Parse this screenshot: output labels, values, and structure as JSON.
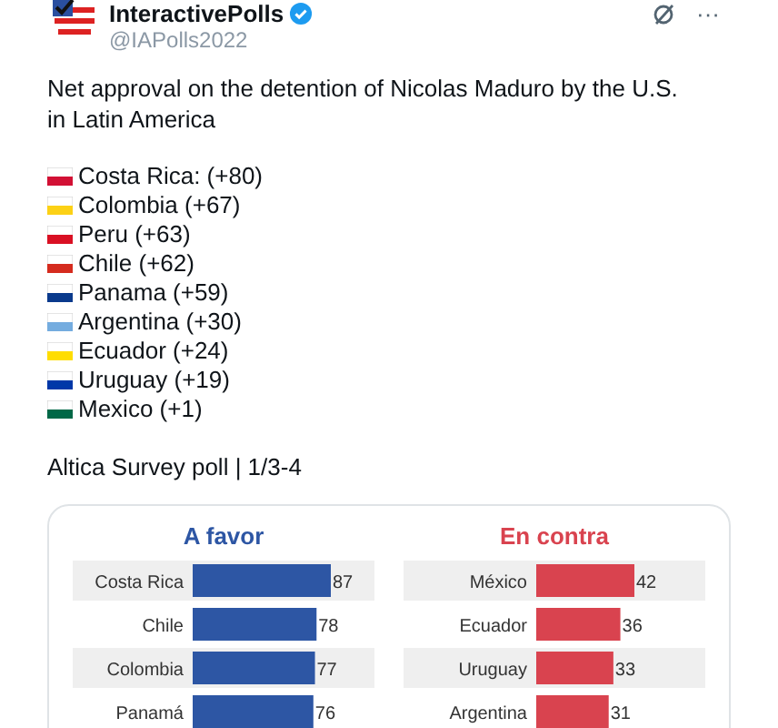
{
  "post": {
    "author": "InteractivePolls",
    "verified": true,
    "handle": "@IAPolls2022",
    "more": "···",
    "text": "Net approval on the detention of Nicolas Maduro by the U.S. in Latin America",
    "list": [
      {
        "label": "Costa Rica: (+80)",
        "color": "#d21034"
      },
      {
        "label": "Colombia (+67)",
        "color": "#fcd116"
      },
      {
        "label": "Peru (+63)",
        "color": "#d91023"
      },
      {
        "label": "Chile (+62)",
        "color": "#d52b1e"
      },
      {
        "label": "Panama (+59)",
        "color": "#0a3a8c"
      },
      {
        "label": "Argentina (+30)",
        "color": "#74acdf"
      },
      {
        "label": "Ecuador (+24)",
        "color": "#ffdd00"
      },
      {
        "label": "Uruguay (+19)",
        "color": "#0038a8"
      },
      {
        "label": "Mexico (+1)",
        "color": "#006847"
      }
    ],
    "source": "Altica Survey poll | 1/3-4",
    "charts": [
      {
        "chart_data": {
          "type": "bar",
          "orientation": "horizontal",
          "title": "A favor",
          "categories": [
            "Costa Rica",
            "Chile",
            "Colombia",
            "Panamá"
          ],
          "series": [
            {
              "color": "#2d56a4",
              "values": [
                87,
                78,
                77,
                76
              ]
            }
          ],
          "data_labels": true
        }
      },
      {
        "chart_data": {
          "type": "bar",
          "orientation": "horizontal",
          "title": "En contra",
          "categories": [
            "México",
            "Ecuador",
            "Uruguay",
            "Argentina"
          ],
          "series": [
            {
              "color": "#d9434f",
              "values": [
                42,
                36,
                33,
                31
              ]
            }
          ],
          "data_labels": true
        }
      }
    ]
  }
}
